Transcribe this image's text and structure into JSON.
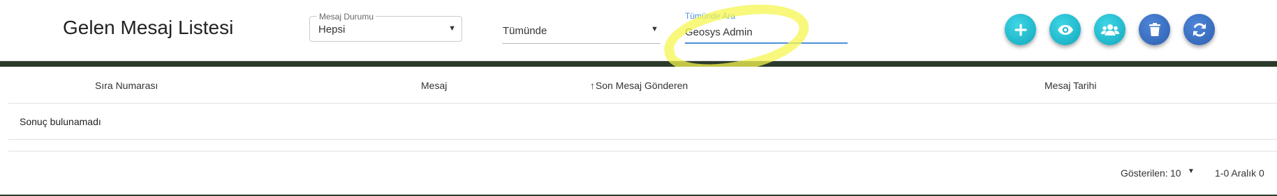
{
  "header": {
    "title": "Gelen Mesaj Listesi"
  },
  "filters": {
    "status": {
      "label": "Mesaj Durumu",
      "value": "Hepsi"
    },
    "scope": {
      "value": "Tümünde"
    },
    "search": {
      "label": "Tümünde Ara",
      "value": "Geosys Admin"
    }
  },
  "actions": [
    {
      "name": "add",
      "icon": "plus-icon",
      "color": "#1bb9cf"
    },
    {
      "name": "view",
      "icon": "eye-icon",
      "color": "#1bb9cf"
    },
    {
      "name": "users",
      "icon": "users-icon",
      "color": "#1bb9cf"
    },
    {
      "name": "delete",
      "icon": "trash-icon",
      "color": "#2d5fb0"
    },
    {
      "name": "refresh",
      "icon": "refresh-icon",
      "color": "#2d5fb0"
    }
  ],
  "table": {
    "columns": [
      "Sıra Numarası",
      "Mesaj",
      "Son Mesaj Gönderen",
      "Mesaj Tarihi"
    ],
    "sorted_column_indicator": "↑",
    "empty_text": "Sonuç bulunamadı"
  },
  "pagination": {
    "rows_label": "Gösterilen:",
    "rows_value": "10",
    "range": "1-0 Aralık 0"
  },
  "colors": {
    "accent": "#1bb9cf",
    "accent_dark": "#2d5fb0",
    "focus_underline": "#4a90d9",
    "highlight": "#f5f550"
  }
}
